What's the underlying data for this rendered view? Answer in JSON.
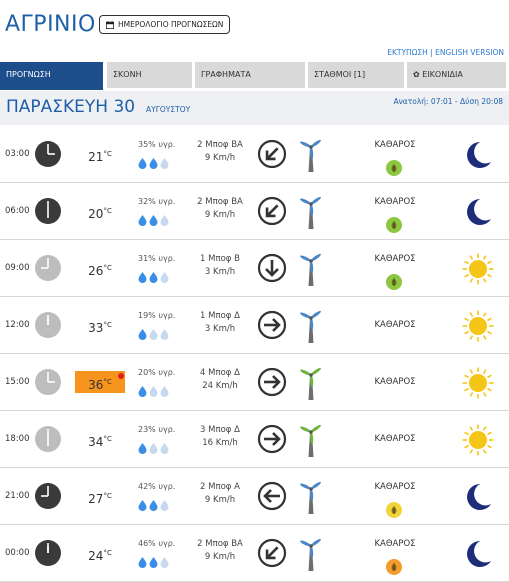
{
  "header": {
    "city": "ΑΓΡΙΝΙΟ",
    "calendar_button": "ΗΜΕΡΟΛΟΓΙΟ ΠΡΟΓΝΩΣΕΩΝ",
    "calendar_icon": "calendar-icon",
    "links": "ΕΚΤΥΠΩΣΗ | ENGLISH VERSION"
  },
  "tabs": [
    {
      "label": "ΠΡΟΓΝΩΣΗ",
      "active": true
    },
    {
      "label": "ΣΚΟΝΗ",
      "active": false
    },
    {
      "label": "ΓΡΑΦΗΜΑΤΑ",
      "active": false
    },
    {
      "label": "ΣΤΑΘΜΟΙ [1]",
      "active": false
    },
    {
      "label": "✿ ΕΙΚΟΝΙΔΙΑ",
      "active": false
    }
  ],
  "day": {
    "name": "ΠΑΡΑΣΚΕΥΗ 30",
    "month": "ΑΥΓΟΥΣΤΟΥ",
    "sun": "Ανατολή: 07:01 - Δύση 20:08"
  },
  "colors": {
    "accent": "#1f5fa8",
    "tab_active": "#1e4d8c",
    "hot_bg": "#f7941d",
    "drop_full": "#3a8ee6",
    "drop_empty": "#c7d9ee",
    "arrow": "#333333",
    "turbine_blue": "#4a86c8",
    "turbine_green": "#6cb33f",
    "moon": "#1e2d7a",
    "sun": "#f5c518",
    "aq_green": "#8dc63f",
    "aq_yellow": "#f1d43a",
    "aq_orange": "#f39c2b"
  },
  "rows": [
    {
      "time": "03:00",
      "night": true,
      "temp": "21",
      "unit": "°C",
      "hot": false,
      "humidity": "35% υγρ.",
      "drops": 2,
      "wind_bf": "2 Μποφ ΒΑ",
      "wind_kmh": "9 Km/h",
      "arrow": "down-left-arrow-icon",
      "turbine": "blue",
      "condition": "ΚΑΘΑΡΟΣ",
      "aq": "green",
      "icon": "moon-icon"
    },
    {
      "time": "06:00",
      "night": true,
      "temp": "20",
      "unit": "°C",
      "hot": false,
      "humidity": "32% υγρ.",
      "drops": 2,
      "wind_bf": "2 Μποφ ΒΑ",
      "wind_kmh": "9 Km/h",
      "arrow": "down-left-arrow-icon",
      "turbine": "blue",
      "condition": "ΚΑΘΑΡΟΣ",
      "aq": "green",
      "icon": "moon-icon"
    },
    {
      "time": "09:00",
      "night": false,
      "temp": "26",
      "unit": "°C",
      "hot": false,
      "humidity": "31% υγρ.",
      "drops": 2,
      "wind_bf": "1 Μποφ Β",
      "wind_kmh": "3 Km/h",
      "arrow": "down-arrow-icon",
      "turbine": "blue",
      "condition": "ΚΑΘΑΡΟΣ",
      "aq": "green",
      "icon": "sun-icon"
    },
    {
      "time": "12:00",
      "night": false,
      "temp": "33",
      "unit": "°C",
      "hot": false,
      "humidity": "19% υγρ.",
      "drops": 1,
      "wind_bf": "1 Μποφ Δ",
      "wind_kmh": "3 Km/h",
      "arrow": "right-arrow-icon",
      "turbine": "blue",
      "condition": "ΚΑΘΑΡΟΣ",
      "aq": "",
      "icon": "sun-icon"
    },
    {
      "time": "15:00",
      "night": false,
      "temp": "36",
      "unit": "°C",
      "hot": true,
      "humidity": "20% υγρ.",
      "drops": 1,
      "wind_bf": "4 Μποφ Δ",
      "wind_kmh": "24 Km/h",
      "arrow": "right-arrow-icon",
      "turbine": "green",
      "condition": "ΚΑΘΑΡΟΣ",
      "aq": "",
      "icon": "sun-icon"
    },
    {
      "time": "18:00",
      "night": false,
      "temp": "34",
      "unit": "°C",
      "hot": false,
      "humidity": "23% υγρ.",
      "drops": 1,
      "wind_bf": "3 Μποφ Δ",
      "wind_kmh": "16 Km/h",
      "arrow": "right-arrow-icon",
      "turbine": "green",
      "condition": "ΚΑΘΑΡΟΣ",
      "aq": "",
      "icon": "sun-icon"
    },
    {
      "time": "21:00",
      "night": true,
      "temp": "27",
      "unit": "°C",
      "hot": false,
      "humidity": "42% υγρ.",
      "drops": 2,
      "wind_bf": "2 Μποφ Α",
      "wind_kmh": "9 Km/h",
      "arrow": "left-arrow-icon",
      "turbine": "blue",
      "condition": "ΚΑΘΑΡΟΣ",
      "aq": "yellow",
      "icon": "moon-icon"
    },
    {
      "time": "00:00",
      "night": true,
      "temp": "24",
      "unit": "°C",
      "hot": false,
      "humidity": "46% υγρ.",
      "drops": 2,
      "wind_bf": "2 Μποφ ΒΑ",
      "wind_kmh": "9 Km/h",
      "arrow": "down-left-arrow-icon",
      "turbine": "blue",
      "condition": "ΚΑΘΑΡΟΣ",
      "aq": "orange",
      "icon": "moon-icon"
    }
  ]
}
